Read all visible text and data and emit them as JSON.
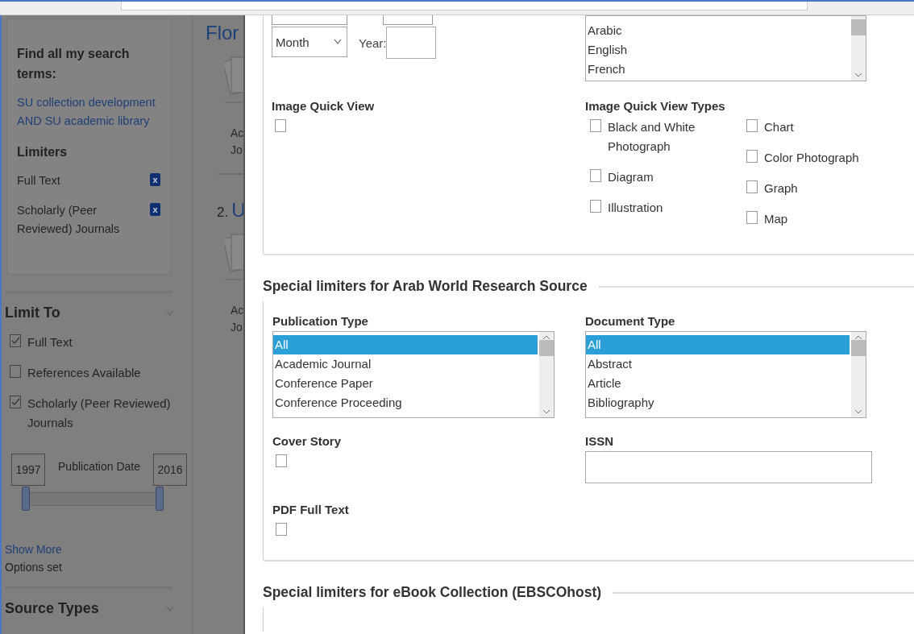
{
  "sidebar": {
    "search_terms": {
      "title": "Find all my search terms:",
      "query": "SU collection development AND SU academic library",
      "limiters_title": "Limiters",
      "limiters": [
        {
          "label": "Full Text",
          "remove": "x"
        },
        {
          "label": "Scholarly (Peer Reviewed) Journals",
          "remove": "x"
        }
      ]
    },
    "limit_to": {
      "title": "Limit To",
      "expanded": true,
      "options": [
        {
          "label": "Full Text",
          "checked": true
        },
        {
          "label": "References Available",
          "checked": false
        },
        {
          "label": "Scholarly (Peer Reviewed) Journals",
          "checked": true
        }
      ],
      "date_from": "1997",
      "date_label": "Publication Date",
      "date_to": "2016",
      "handles": [
        {
          "level": 0
        },
        {
          "level": 1
        }
      ],
      "show_more": "Show More",
      "options_set": "Options set"
    },
    "source_types": {
      "title": "Source Types",
      "expanded": false
    }
  },
  "results": [
    {
      "title": "Flor",
      "type_lines": [
        "Ac",
        "Jo"
      ]
    },
    {
      "number": "2.",
      "title": "U",
      "type_lines": [
        "Ac",
        "Jo"
      ]
    }
  ],
  "dialog": {
    "month_select": {
      "value": "Month"
    },
    "year_label": "Year:",
    "language_list": {
      "options": [
        {
          "label": "Arabic",
          "selected": false
        },
        {
          "label": "English",
          "selected": false
        },
        {
          "label": "French",
          "selected": false
        }
      ]
    },
    "image_quick_view": {
      "label": "Image Quick View",
      "checked": false
    },
    "image_quick_view_types": {
      "label": "Image Quick View Types",
      "columns": [
        [
          {
            "label": "Black and White Photograph",
            "checked": false
          },
          {
            "label": "Diagram",
            "checked": false
          },
          {
            "label": "Illustration",
            "checked": false
          }
        ],
        [
          {
            "label": "Chart",
            "checked": false
          },
          {
            "label": "Color Photograph",
            "checked": false
          },
          {
            "label": "Graph",
            "checked": false
          },
          {
            "label": "Map",
            "checked": false
          }
        ]
      ]
    },
    "sections": [
      {
        "title": "Special limiters for Arab World Research Source",
        "publication_type": {
          "label": "Publication Type",
          "options": [
            {
              "label": "All",
              "selected": true
            },
            {
              "label": "Academic Journal",
              "selected": false
            },
            {
              "label": "Conference Paper",
              "selected": false
            },
            {
              "label": "Conference Proceeding",
              "selected": false
            }
          ]
        },
        "document_type": {
          "label": "Document Type",
          "options": [
            {
              "label": "All",
              "selected": true
            },
            {
              "label": "Abstract",
              "selected": false
            },
            {
              "label": "Article",
              "selected": false
            },
            {
              "label": "Bibliography",
              "selected": false
            }
          ]
        },
        "cover_story": {
          "label": "Cover Story",
          "checked": false
        },
        "issn": {
          "label": "ISSN"
        },
        "pdf_full_text": {
          "label": "PDF Full Text",
          "checked": false
        }
      },
      {
        "title": "Special limiters for eBook Collection (EBSCOhost)"
      }
    ]
  }
}
